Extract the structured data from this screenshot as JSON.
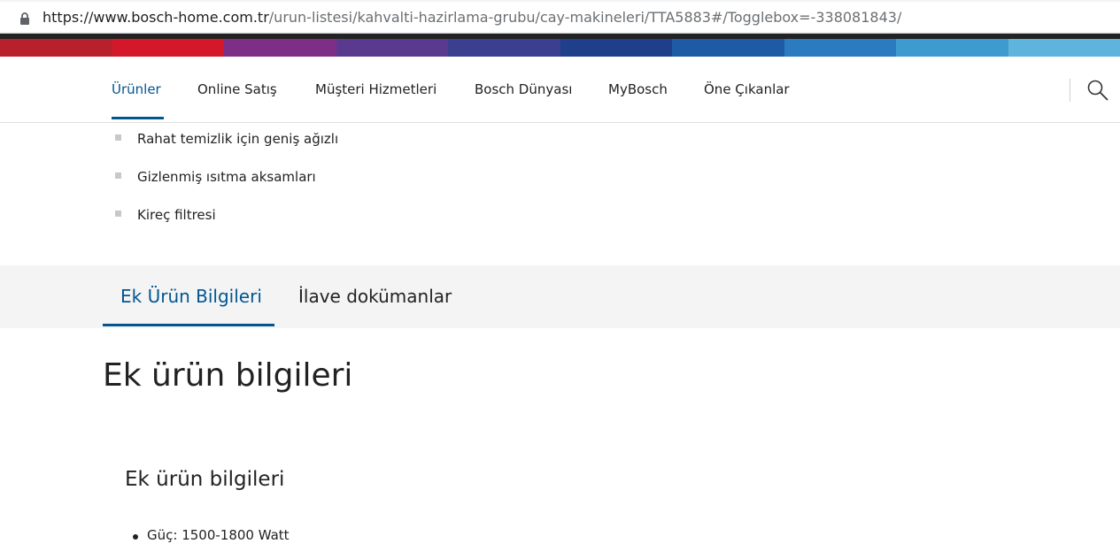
{
  "browser": {
    "url_host": "https://www.bosch-home.com.tr",
    "url_path": "/urun-listesi/kahvalti-hazirlama-grubu/cay-makineleri/TTA5883#/Togglebox=-338081843/",
    "lock_icon": "lock-icon"
  },
  "brand_band_colors": [
    "#b8212c",
    "#d5172a",
    "#7d2f87",
    "#5a3a8e",
    "#3a3f8f",
    "#203f8a",
    "#1f5aa5",
    "#2a7bbf",
    "#3e9bd0",
    "#5fb4dd"
  ],
  "nav": {
    "items": [
      {
        "label": "Ürünler",
        "active": true
      },
      {
        "label": "Online Satış",
        "active": false
      },
      {
        "label": "Müşteri Hizmetleri",
        "active": false
      },
      {
        "label": "Bosch Dünyası",
        "active": false
      },
      {
        "label": "MyBosch",
        "active": false
      },
      {
        "label": "Öne Çıkanlar",
        "active": false
      }
    ],
    "search_icon": "search-icon",
    "accent_color": "#005691"
  },
  "features": [
    "Rahat temizlik için geniş ağızlı",
    "Gizlenmiş ısıtma aksamları",
    "Kireç filtresi"
  ],
  "tabs": [
    {
      "label": "Ek Ürün Bilgileri",
      "active": true
    },
    {
      "label": "İlave dokümanlar",
      "active": false
    }
  ],
  "section": {
    "title": "Ek ürün bilgileri",
    "subtitle": "Ek ürün bilgileri",
    "specs": [
      "Güç: 1500-1800 Watt"
    ]
  }
}
